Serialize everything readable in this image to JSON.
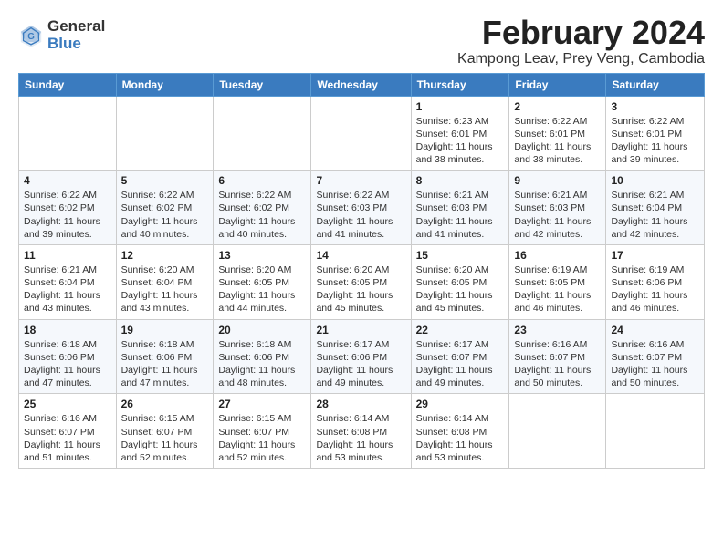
{
  "logo": {
    "general": "General",
    "blue": "Blue"
  },
  "title": "February 2024",
  "location": "Kampong Leav, Prey Veng, Cambodia",
  "days_of_week": [
    "Sunday",
    "Monday",
    "Tuesday",
    "Wednesday",
    "Thursday",
    "Friday",
    "Saturday"
  ],
  "weeks": [
    [
      {
        "day": "",
        "info": ""
      },
      {
        "day": "",
        "info": ""
      },
      {
        "day": "",
        "info": ""
      },
      {
        "day": "",
        "info": ""
      },
      {
        "day": "1",
        "info": "Sunrise: 6:23 AM\nSunset: 6:01 PM\nDaylight: 11 hours\nand 38 minutes."
      },
      {
        "day": "2",
        "info": "Sunrise: 6:22 AM\nSunset: 6:01 PM\nDaylight: 11 hours\nand 38 minutes."
      },
      {
        "day": "3",
        "info": "Sunrise: 6:22 AM\nSunset: 6:01 PM\nDaylight: 11 hours\nand 39 minutes."
      }
    ],
    [
      {
        "day": "4",
        "info": "Sunrise: 6:22 AM\nSunset: 6:02 PM\nDaylight: 11 hours\nand 39 minutes."
      },
      {
        "day": "5",
        "info": "Sunrise: 6:22 AM\nSunset: 6:02 PM\nDaylight: 11 hours\nand 40 minutes."
      },
      {
        "day": "6",
        "info": "Sunrise: 6:22 AM\nSunset: 6:02 PM\nDaylight: 11 hours\nand 40 minutes."
      },
      {
        "day": "7",
        "info": "Sunrise: 6:22 AM\nSunset: 6:03 PM\nDaylight: 11 hours\nand 41 minutes."
      },
      {
        "day": "8",
        "info": "Sunrise: 6:21 AM\nSunset: 6:03 PM\nDaylight: 11 hours\nand 41 minutes."
      },
      {
        "day": "9",
        "info": "Sunrise: 6:21 AM\nSunset: 6:03 PM\nDaylight: 11 hours\nand 42 minutes."
      },
      {
        "day": "10",
        "info": "Sunrise: 6:21 AM\nSunset: 6:04 PM\nDaylight: 11 hours\nand 42 minutes."
      }
    ],
    [
      {
        "day": "11",
        "info": "Sunrise: 6:21 AM\nSunset: 6:04 PM\nDaylight: 11 hours\nand 43 minutes."
      },
      {
        "day": "12",
        "info": "Sunrise: 6:20 AM\nSunset: 6:04 PM\nDaylight: 11 hours\nand 43 minutes."
      },
      {
        "day": "13",
        "info": "Sunrise: 6:20 AM\nSunset: 6:05 PM\nDaylight: 11 hours\nand 44 minutes."
      },
      {
        "day": "14",
        "info": "Sunrise: 6:20 AM\nSunset: 6:05 PM\nDaylight: 11 hours\nand 45 minutes."
      },
      {
        "day": "15",
        "info": "Sunrise: 6:20 AM\nSunset: 6:05 PM\nDaylight: 11 hours\nand 45 minutes."
      },
      {
        "day": "16",
        "info": "Sunrise: 6:19 AM\nSunset: 6:05 PM\nDaylight: 11 hours\nand 46 minutes."
      },
      {
        "day": "17",
        "info": "Sunrise: 6:19 AM\nSunset: 6:06 PM\nDaylight: 11 hours\nand 46 minutes."
      }
    ],
    [
      {
        "day": "18",
        "info": "Sunrise: 6:18 AM\nSunset: 6:06 PM\nDaylight: 11 hours\nand 47 minutes."
      },
      {
        "day": "19",
        "info": "Sunrise: 6:18 AM\nSunset: 6:06 PM\nDaylight: 11 hours\nand 47 minutes."
      },
      {
        "day": "20",
        "info": "Sunrise: 6:18 AM\nSunset: 6:06 PM\nDaylight: 11 hours\nand 48 minutes."
      },
      {
        "day": "21",
        "info": "Sunrise: 6:17 AM\nSunset: 6:06 PM\nDaylight: 11 hours\nand 49 minutes."
      },
      {
        "day": "22",
        "info": "Sunrise: 6:17 AM\nSunset: 6:07 PM\nDaylight: 11 hours\nand 49 minutes."
      },
      {
        "day": "23",
        "info": "Sunrise: 6:16 AM\nSunset: 6:07 PM\nDaylight: 11 hours\nand 50 minutes."
      },
      {
        "day": "24",
        "info": "Sunrise: 6:16 AM\nSunset: 6:07 PM\nDaylight: 11 hours\nand 50 minutes."
      }
    ],
    [
      {
        "day": "25",
        "info": "Sunrise: 6:16 AM\nSunset: 6:07 PM\nDaylight: 11 hours\nand 51 minutes."
      },
      {
        "day": "26",
        "info": "Sunrise: 6:15 AM\nSunset: 6:07 PM\nDaylight: 11 hours\nand 52 minutes."
      },
      {
        "day": "27",
        "info": "Sunrise: 6:15 AM\nSunset: 6:07 PM\nDaylight: 11 hours\nand 52 minutes."
      },
      {
        "day": "28",
        "info": "Sunrise: 6:14 AM\nSunset: 6:08 PM\nDaylight: 11 hours\nand 53 minutes."
      },
      {
        "day": "29",
        "info": "Sunrise: 6:14 AM\nSunset: 6:08 PM\nDaylight: 11 hours\nand 53 minutes."
      },
      {
        "day": "",
        "info": ""
      },
      {
        "day": "",
        "info": ""
      }
    ]
  ]
}
